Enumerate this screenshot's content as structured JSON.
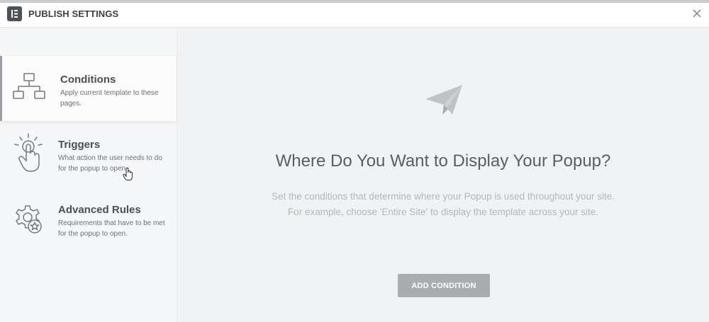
{
  "header": {
    "title": "PUBLISH SETTINGS",
    "logo_icon": "elementor-logo-icon",
    "close_icon": "close-icon"
  },
  "sidebar": {
    "items": [
      {
        "label": "Conditions",
        "description": "Apply current template to these pages.",
        "icon": "sitemap-icon",
        "active": true
      },
      {
        "label": "Triggers",
        "description": "What action the user needs to do for the popup to open.",
        "icon": "hand-tap-icon",
        "active": false
      },
      {
        "label": "Advanced Rules",
        "description": "Requirements that have to be met for the popup to open.",
        "icon": "gear-star-icon",
        "active": false
      }
    ]
  },
  "main": {
    "icon": "paper-plane-icon",
    "title": "Where Do You Want to Display Your Popup?",
    "subtitle_line1": "Set the conditions that determine where your Popup is used throughout your site.",
    "subtitle_line2": "For example, choose 'Entire Site' to display the template across your site.",
    "add_button_label": "ADD CONDITION"
  },
  "colors": {
    "header_bg": "#ffffff",
    "sidebar_bg": "#f6f7f8",
    "main_bg": "#f1f2f3",
    "button_bg": "#a9acb0",
    "title_text": "#5a5e64",
    "subtitle_text": "#b3b6ba"
  }
}
